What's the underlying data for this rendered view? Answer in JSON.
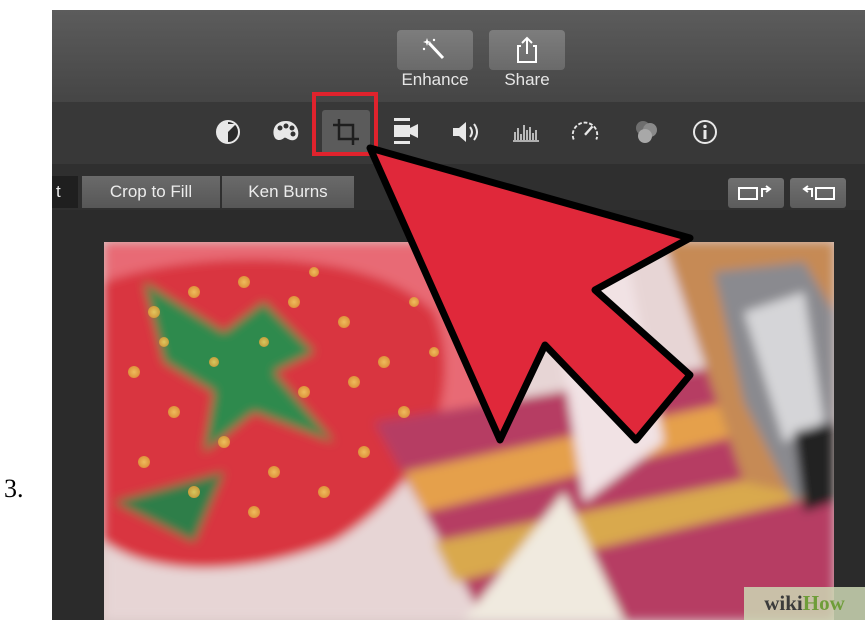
{
  "step": {
    "number": "3."
  },
  "toolbar": {
    "enhance_label": "Enhance",
    "share_label": "Share"
  },
  "adjust_tools": [
    {
      "name": "color-balance-icon",
      "selected": false
    },
    {
      "name": "color-correction-icon",
      "selected": false
    },
    {
      "name": "crop-icon",
      "selected": true
    },
    {
      "name": "stabilization-icon",
      "selected": false
    },
    {
      "name": "volume-icon",
      "selected": false
    },
    {
      "name": "noise-reduction-icon",
      "selected": false
    },
    {
      "name": "speed-icon",
      "selected": false
    },
    {
      "name": "clip-filter-icon",
      "selected": false
    },
    {
      "name": "info-icon",
      "selected": false
    }
  ],
  "crop_bar": {
    "fit_partial": "t",
    "crop_to_fill": "Crop to Fill",
    "ken_burns": "Ken Burns"
  },
  "watermark": {
    "part1": "wiki",
    "part2": "How"
  },
  "colors": {
    "highlight": "#e0232d",
    "arrow_fill": "#e0283a",
    "toolbar_bg": "#4d4d4d",
    "adjust_bar_bg": "#383838"
  }
}
